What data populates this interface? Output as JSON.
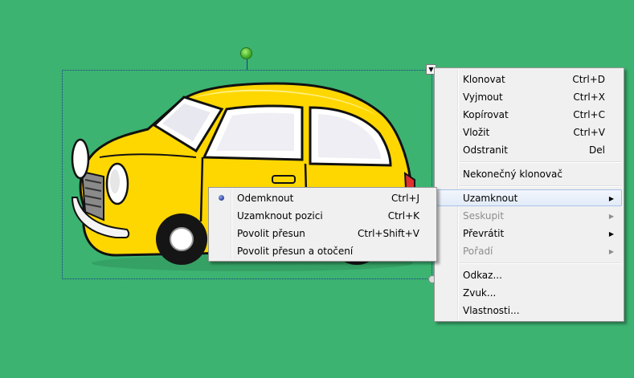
{
  "context_menu": {
    "items": [
      {
        "label": "Klonovat",
        "shortcut": "Ctrl+D"
      },
      {
        "label": "Vyjmout",
        "shortcut": "Ctrl+X"
      },
      {
        "label": "Kopírovat",
        "shortcut": "Ctrl+C"
      },
      {
        "label": "Vložit",
        "shortcut": "Ctrl+V"
      },
      {
        "label": "Odstranit",
        "shortcut": "Del"
      },
      {
        "label": "Nekonečný klonovač"
      },
      {
        "label": "Uzamknout",
        "submenu": true,
        "highlighted": true
      },
      {
        "label": "Seskupit",
        "submenu": true,
        "disabled": true
      },
      {
        "label": "Převrátit",
        "submenu": true
      },
      {
        "label": "Pořadí",
        "submenu": true,
        "disabled": true
      },
      {
        "label": "Odkaz..."
      },
      {
        "label": "Zvuk..."
      },
      {
        "label": "Vlastnosti..."
      }
    ]
  },
  "lock_submenu": {
    "items": [
      {
        "label": "Odemknout",
        "shortcut": "Ctrl+J",
        "selected": true
      },
      {
        "label": "Uzamknout pozici",
        "shortcut": "Ctrl+K"
      },
      {
        "label": "Povolit přesun",
        "shortcut": "Ctrl+Shift+V"
      },
      {
        "label": "Povolit přesun a otočení"
      }
    ]
  },
  "colors": {
    "canvas_background": "#3cb371",
    "car_body": "#ffd700",
    "menu_background": "#f0f0f0",
    "menu_highlight_border": "#a8c2e8"
  },
  "icons": {
    "rotate_handle": "green-circle-handle",
    "object_menu_button": "triangle-down",
    "submenu_arrow": "triangle-right",
    "selected_bullet": "radio-bullet"
  }
}
